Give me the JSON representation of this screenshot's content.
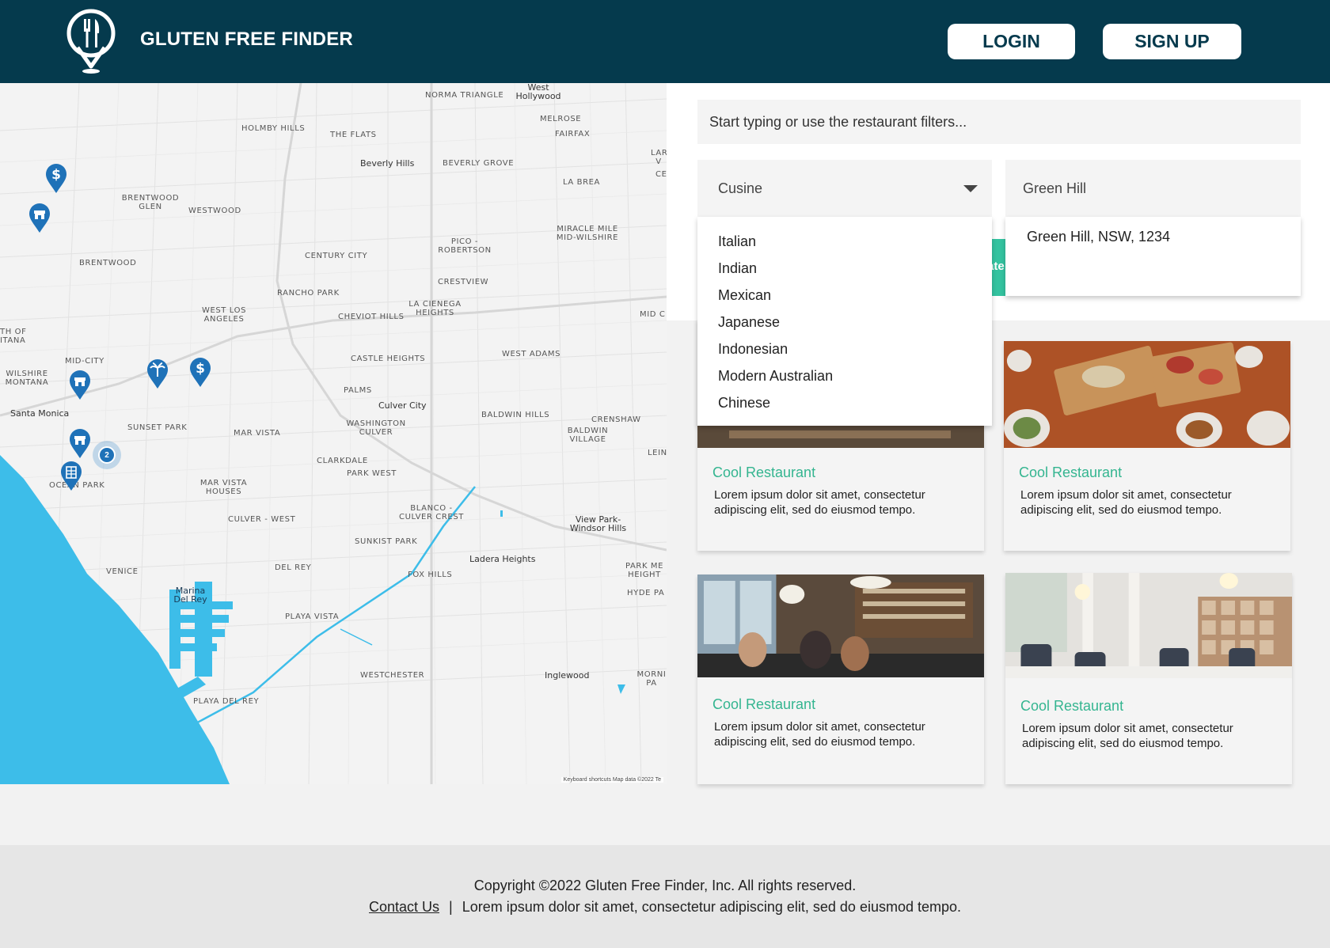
{
  "header": {
    "brand": "GLUTEN FREE FINDER",
    "login_label": "LOGIN",
    "signup_label": "SIGN UP",
    "logo_icon": "fork-knife-location-pin-icon"
  },
  "search": {
    "placeholder": "Start typing or use the restaurant filters..."
  },
  "filters": {
    "cuisine_label": "Cusine",
    "cuisine_options": [
      "Italian",
      "Indian",
      "Mexican",
      "Japanese",
      "Indonesian",
      "Modern Australian",
      "Chinese"
    ],
    "location_value": "Green Hill",
    "location_suggestion": "Green Hill, NSW, 1234",
    "teal_tab_text": "ate"
  },
  "map": {
    "labels": {
      "norma_triangle": "NORMA TRIANGLE",
      "west_hollywood": "West Hollywood",
      "holmby_hills": "HOLMBY HILLS",
      "the_flats": "THE FLATS",
      "melrose": "MELROSE",
      "fairfax": "FAIRFAX",
      "beverly_hills": "Beverly Hills",
      "beverly_grove": "BEVERLY GROVE",
      "brentwood_glen": "BRENTWOOD GLEN",
      "westwood": "WESTWOOD",
      "la_brea": "LA BREA",
      "miracle_mile": "MIRACLE MILE MID-WILSHIRE",
      "pico_robertson": "PICO - ROBERTSON",
      "century_city": "CENTURY CITY",
      "brentwood": "BRENTWOOD",
      "crestview": "CRESTVIEW",
      "rancho_park": "RANCHO PARK",
      "la_cienega": "LA CIENEGA HEIGHTS",
      "west_la": "WEST LOS ANGELES",
      "cheviot_hills": "CHEVIOT HILLS",
      "th_of_itana": "TH OF ITANA",
      "mid_city": "MID-CITY",
      "castle_heights": "CASTLE HEIGHTS",
      "west_adams": "WEST ADAMS",
      "wilshire_montana": "WILSHIRE MONTANA",
      "palms": "PALMS",
      "culver_city": "Culver City",
      "santa_monica": "Santa Monica",
      "sunset_park": "SUNSET PARK",
      "baldwin_hills": "BALDWIN HILLS",
      "crenshaw": "CRENSHAW",
      "washington_culver": "WASHINGTON CULVER",
      "mar_vista": "MAR VISTA",
      "baldwin_village": "BALDWIN VILLAGE",
      "clarkdale": "CLARKDALE",
      "park_west": "PARK WEST",
      "ocean_park": "OCEAN PARK",
      "mar_vista_houses": "MAR VISTA HOUSES",
      "culver_west": "CULVER - WEST",
      "blanco_culver": "BLANCO - CULVER CREST",
      "view_park": "View Park-Windsor Hills",
      "sunkist_park": "SUNKIST PARK",
      "ladera_heights": "Ladera Heights",
      "del_rey": "DEL REY",
      "venice": "VENICE",
      "fox_hills": "FOX HILLS",
      "park_mesa": "PARK ME HEIGHT",
      "hyde_park": "HYDE PA",
      "marina_del_rey": "Marina Del Rey",
      "playa_vista": "PLAYA VISTA",
      "westchester": "WESTCHESTER",
      "inglewood": "Inglewood",
      "morning": "MORNI PA",
      "playa_del_rey": "PLAYA DEL REY",
      "leimert": "LEIN",
      "mid_c": "MID C",
      "la_v": "LAR V",
      "ce": "CE"
    },
    "attribution": "Keyboard shortcuts    Map data ©2022    Te",
    "cluster_count": "2",
    "pins": [
      "dollar-pin-icon",
      "shop-pin-icon",
      "palm-tree-pin-icon",
      "dollar-pin-icon",
      "shop-pin-icon",
      "shop-pin-icon",
      "hotel-pin-icon"
    ]
  },
  "cards": [
    {
      "title": "Cool Restaurant",
      "desc": "Lorem ipsum dolor sit amet, consectetur adipiscing elit, sed do eiusmod tempo."
    },
    {
      "title": "Cool Restaurant",
      "desc": "Lorem ipsum dolor sit amet, consectetur adipiscing elit, sed do eiusmod tempo."
    },
    {
      "title": "Cool Restaurant",
      "desc": "Lorem ipsum dolor sit amet, consectetur adipiscing elit, sed do eiusmod tempo."
    },
    {
      "title": "Cool Restaurant",
      "desc": "Lorem ipsum dolor sit amet, consectetur adipiscing elit, sed do eiusmod tempo."
    }
  ],
  "footer": {
    "copyright": "Copyright ©2022 Gluten Free Finder, Inc. All rights reserved.",
    "contact_label": "Contact Us",
    "separator": "|",
    "tagline": "Lorem ipsum dolor sit amet, consectetur adipiscing elit, sed do eiusmod tempo."
  },
  "colors": {
    "header_bg": "#053a4d",
    "accent_teal": "#34b590",
    "ocean": "#3dbde9",
    "pin_blue": "#1f72b8"
  }
}
